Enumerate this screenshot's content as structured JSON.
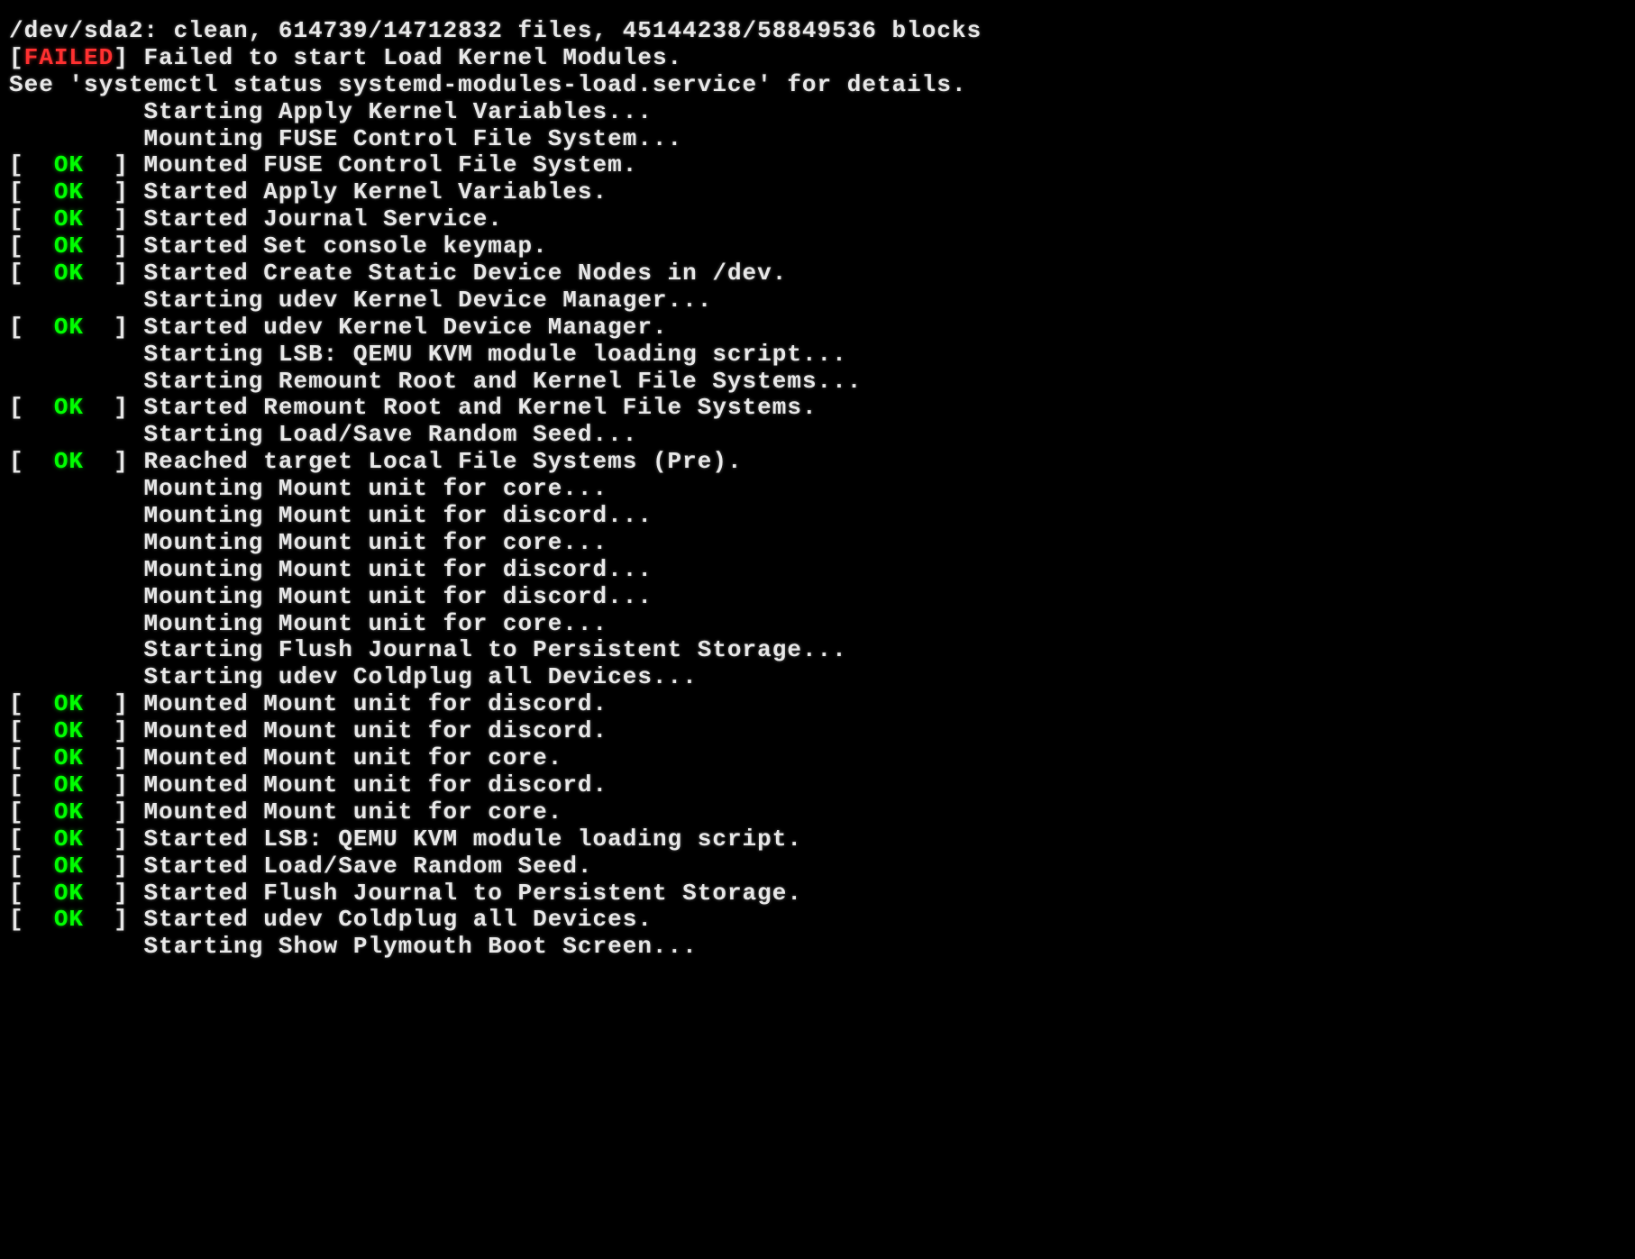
{
  "lines": [
    {
      "status": null,
      "text": "/dev/sda2: clean, 614739/14712832 files, 45144238/58849536 blocks",
      "indent": 0
    },
    {
      "status": "FAILED",
      "text": "Failed to start Load Kernel Modules.",
      "indent": 0
    },
    {
      "status": null,
      "text": "See 'systemctl status systemd-modules-load.service' for details.",
      "indent": 0
    },
    {
      "status": null,
      "text": "Starting Apply Kernel Variables...",
      "indent": 9
    },
    {
      "status": null,
      "text": "Mounting FUSE Control File System...",
      "indent": 9
    },
    {
      "status": "OK",
      "text": "Mounted FUSE Control File System.",
      "indent": 0
    },
    {
      "status": "OK",
      "text": "Started Apply Kernel Variables.",
      "indent": 0
    },
    {
      "status": "OK",
      "text": "Started Journal Service.",
      "indent": 0
    },
    {
      "status": "OK",
      "text": "Started Set console keymap.",
      "indent": 0
    },
    {
      "status": "OK",
      "text": "Started Create Static Device Nodes in /dev.",
      "indent": 0
    },
    {
      "status": null,
      "text": "Starting udev Kernel Device Manager...",
      "indent": 9
    },
    {
      "status": "OK",
      "text": "Started udev Kernel Device Manager.",
      "indent": 0
    },
    {
      "status": null,
      "text": "Starting LSB: QEMU KVM module loading script...",
      "indent": 9
    },
    {
      "status": null,
      "text": "Starting Remount Root and Kernel File Systems...",
      "indent": 9
    },
    {
      "status": "OK",
      "text": "Started Remount Root and Kernel File Systems.",
      "indent": 0
    },
    {
      "status": null,
      "text": "Starting Load/Save Random Seed...",
      "indent": 9
    },
    {
      "status": "OK",
      "text": "Reached target Local File Systems (Pre).",
      "indent": 0
    },
    {
      "status": null,
      "text": "Mounting Mount unit for core...",
      "indent": 9
    },
    {
      "status": null,
      "text": "Mounting Mount unit for discord...",
      "indent": 9
    },
    {
      "status": null,
      "text": "Mounting Mount unit for core...",
      "indent": 9
    },
    {
      "status": null,
      "text": "Mounting Mount unit for discord...",
      "indent": 9
    },
    {
      "status": null,
      "text": "Mounting Mount unit for discord...",
      "indent": 9
    },
    {
      "status": null,
      "text": "Mounting Mount unit for core...",
      "indent": 9
    },
    {
      "status": null,
      "text": "Starting Flush Journal to Persistent Storage...",
      "indent": 9
    },
    {
      "status": null,
      "text": "Starting udev Coldplug all Devices...",
      "indent": 9
    },
    {
      "status": "OK",
      "text": "Mounted Mount unit for discord.",
      "indent": 0
    },
    {
      "status": "OK",
      "text": "Mounted Mount unit for discord.",
      "indent": 0
    },
    {
      "status": "OK",
      "text": "Mounted Mount unit for core.",
      "indent": 0
    },
    {
      "status": "OK",
      "text": "Mounted Mount unit for discord.",
      "indent": 0
    },
    {
      "status": "OK",
      "text": "Mounted Mount unit for core.",
      "indent": 0
    },
    {
      "status": "OK",
      "text": "Started LSB: QEMU KVM module loading script.",
      "indent": 0
    },
    {
      "status": "OK",
      "text": "Started Load/Save Random Seed.",
      "indent": 0
    },
    {
      "status": "OK",
      "text": "Started Flush Journal to Persistent Storage.",
      "indent": 0
    },
    {
      "status": "OK",
      "text": "Started udev Coldplug all Devices.",
      "indent": 0
    },
    {
      "status": null,
      "text": "Starting Show Plymouth Boot Screen...",
      "indent": 9
    }
  ],
  "labels": {
    "ok": "OK",
    "failed": "FAILED"
  }
}
